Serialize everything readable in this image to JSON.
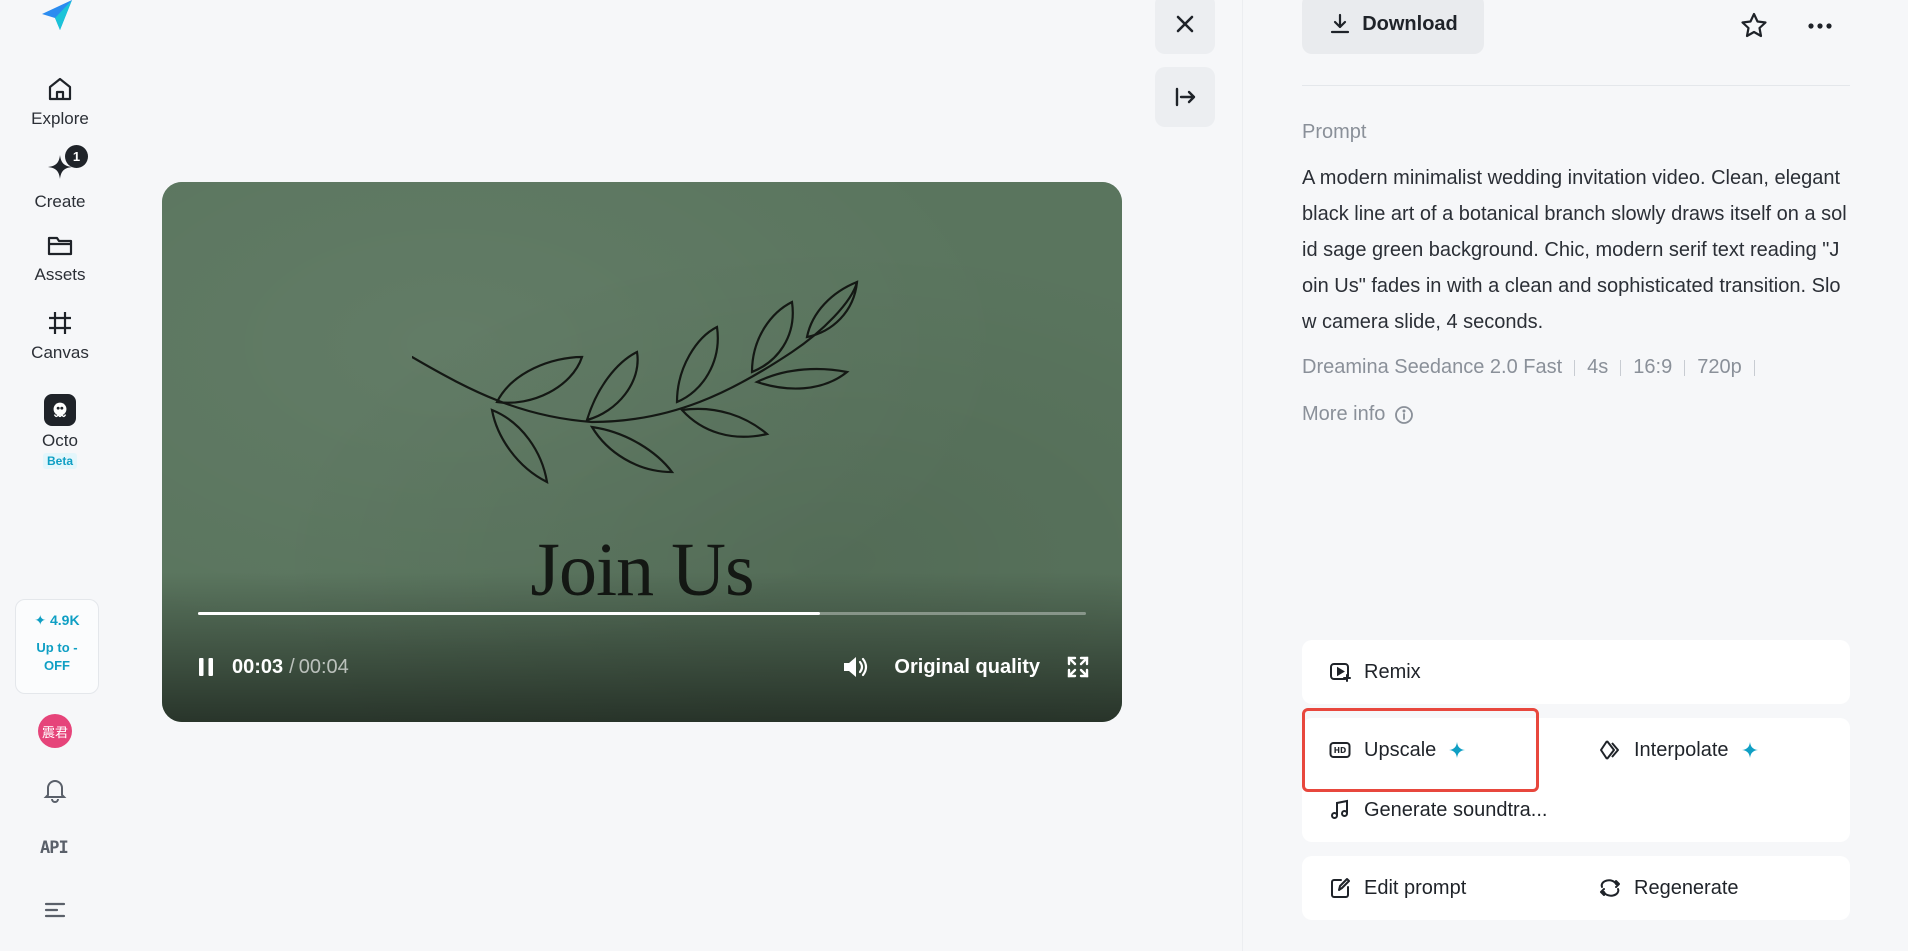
{
  "sidebar": {
    "logo": "dreamina-logo",
    "items": [
      {
        "label": "Explore",
        "icon": "home-icon"
      },
      {
        "label": "Create",
        "icon": "sparkle-icon",
        "badge": "1"
      },
      {
        "label": "Assets",
        "icon": "folder-icon"
      },
      {
        "label": "Canvas",
        "icon": "crop-icon"
      },
      {
        "label": "Octo",
        "icon": "octo-icon",
        "tag": "Beta"
      }
    ],
    "credits": "✦ 4.9K",
    "promo": "Up to - OFF",
    "avatar_text": "震君",
    "api_label": "API"
  },
  "controls": {
    "close_icon": "close-icon",
    "collapse_icon": "collapse-panel-icon"
  },
  "video": {
    "overlay_title": "Join Us",
    "current_time": "00:03",
    "separator": "/",
    "total_time": "00:04",
    "progress": 0.7,
    "quality": "Original quality",
    "background_color": "#5a755e"
  },
  "panel": {
    "download_label": "Download",
    "prompt_label": "Prompt",
    "prompt_text": "A modern minimalist wedding invitation video. Clean, elegant black line art of a botanical branch slowly draws itself on a solid sage green background. Chic, modern serif text reading \"Join Us\" fades in with a clean and sophisticated transition. Slow camera slide, 4 seconds.",
    "meta": [
      "Dreamina Seedance 2.0 Fast",
      "4s",
      "16:9",
      "720p"
    ],
    "more_info": "More info",
    "actions": {
      "remix": "Remix",
      "upscale": "Upscale",
      "interpolate": "Interpolate",
      "soundtrack": "Generate soundtra...",
      "edit_prompt": "Edit prompt",
      "regenerate": "Regenerate"
    }
  },
  "colors": {
    "accent": "#0f9fc4",
    "highlight": "#e8473d",
    "avatar": "#e6447a"
  }
}
